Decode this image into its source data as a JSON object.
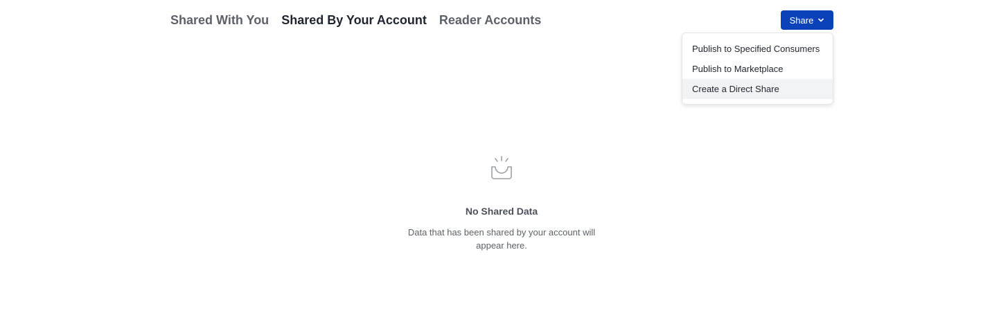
{
  "tabs": [
    {
      "label": "Shared With You",
      "active": false
    },
    {
      "label": "Shared By Your Account",
      "active": true
    },
    {
      "label": "Reader Accounts",
      "active": false
    }
  ],
  "share_button": {
    "label": "Share",
    "icon": "chevron-down-icon",
    "color": "#0b42b9"
  },
  "share_menu": {
    "items": [
      {
        "label": "Publish to Specified Consumers"
      },
      {
        "label": "Publish to Marketplace"
      },
      {
        "label": "Create a Direct Share",
        "hovered": true
      }
    ]
  },
  "empty_state": {
    "icon": "empty-inbox-icon",
    "title": "No Shared Data",
    "description": "Data that has been shared by your account will appear here."
  }
}
